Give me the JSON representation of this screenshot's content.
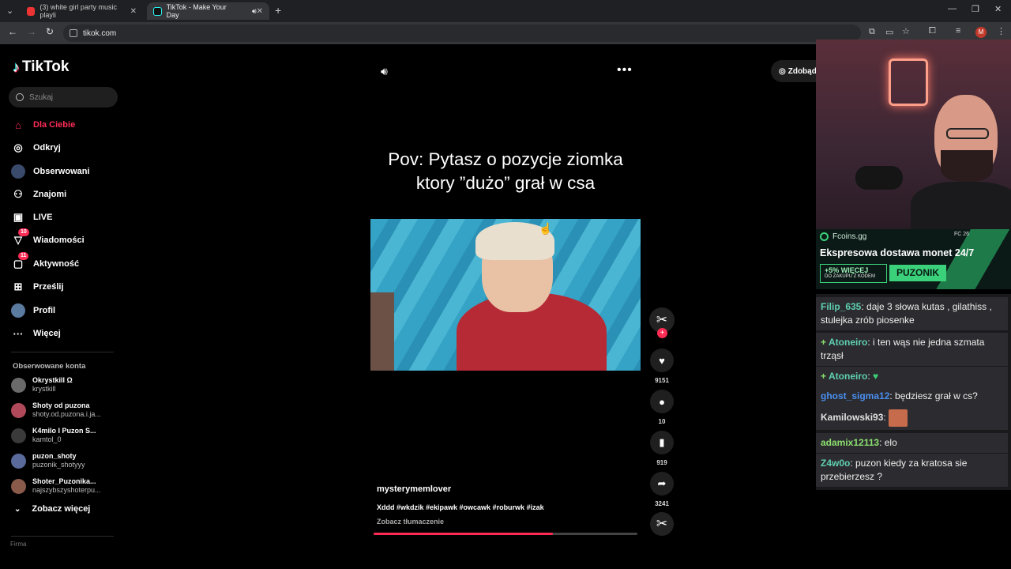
{
  "browser": {
    "tabs": [
      {
        "label": "(3) white girl party music playli",
        "active": false
      },
      {
        "label": "TikTok - Make Your Day",
        "active": true
      }
    ],
    "new_tab": "+",
    "url": "tikok.com",
    "profile_initial": "M"
  },
  "sidebar": {
    "brand": "TikTok",
    "search_placeholder": "Szukaj",
    "nav": [
      {
        "label": "Dla Ciebie",
        "icon": "home-icon",
        "active": true
      },
      {
        "label": "Odkryj",
        "icon": "compass-icon"
      },
      {
        "label": "Obserwowani",
        "icon": "following-icon"
      },
      {
        "label": "Znajomi",
        "icon": "friends-icon"
      },
      {
        "label": "LIVE",
        "icon": "live-icon"
      },
      {
        "label": "Wiadomości",
        "icon": "messages-icon",
        "badge": "10"
      },
      {
        "label": "Aktywność",
        "icon": "activity-icon",
        "badge": "11"
      },
      {
        "label": "Prześlij",
        "icon": "upload-icon"
      },
      {
        "label": "Profil",
        "icon": "profile-icon"
      },
      {
        "label": "Więcej",
        "icon": "more-icon"
      }
    ],
    "followed_title": "Obserwowane konta",
    "accounts": [
      {
        "name": "Okrystkill Ω",
        "handle": "krystkill",
        "color": "#6a6a6a"
      },
      {
        "name": "Shoty od puzona",
        "handle": "shoty.od.puzona.i.ja...",
        "color": "#b04a5a"
      },
      {
        "name": "K4milo I Puzon S...",
        "handle": "kamtol_0",
        "color": "#3a3a3a"
      },
      {
        "name": "puzon_shoty",
        "handle": "puzonik_shotyyy",
        "color": "#5a6a9a"
      },
      {
        "name": "Shoter_Puzonika...",
        "handle": "najszybszyshoterpu...",
        "color": "#8a5a4a"
      }
    ],
    "see_more": "Zobacz więcej",
    "footer_cut": "Firma"
  },
  "video": {
    "caption": "Pov: Pytasz o pozycje ziomka ktory ”dużo” grał w csa",
    "get_button": "Zdobąd",
    "likes": "9151",
    "comments": "10",
    "saves": "919",
    "shares": "3241",
    "author": "mysterymemlover",
    "description": "Xddd #wkdzik #ekipawk #owcawk #roburwk #izak",
    "translate": "Zobacz tłumaczenie",
    "progress": 0.68
  },
  "ad": {
    "brand": "Fcoins.gg",
    "topbar": "FC 26",
    "title": "Ekspresowa dostawa monet 24/7",
    "bonus_line1": "+5% WIĘCEJ",
    "bonus_line2": "DO ZAKUPU Z KODEM",
    "code": "PUZONIK"
  },
  "chat": [
    {
      "user": "Filip_635",
      "color": "#5fd0b0",
      "text": ": daje 3 słowa kutas , gilathiss , stulejka zrób piosenke"
    },
    {
      "user": "Atoneiro",
      "color": "#5fd0b0",
      "text": ": i ten wąs nie jedna szmata trząsł",
      "mark": "+"
    },
    {
      "user": "Atoneiro",
      "color": "#5fd0b0",
      "text": ":",
      "mark": "+",
      "heart": "♥"
    },
    {
      "user": "ghost_sigma12",
      "color": "#4a8ff0",
      "text": ": będziesz grał w cs?"
    },
    {
      "user": "Kamilowski93",
      "color": "#e0e0e0",
      "text": ":",
      "emote": true
    },
    {
      "user": "adamix12113",
      "color": "#8ce06f",
      "text": ": elo"
    },
    {
      "user": "Z4w0o",
      "color": "#5fd0b0",
      "text": ": puzon kiedy za kratosa sie przebierzesz ?"
    }
  ]
}
